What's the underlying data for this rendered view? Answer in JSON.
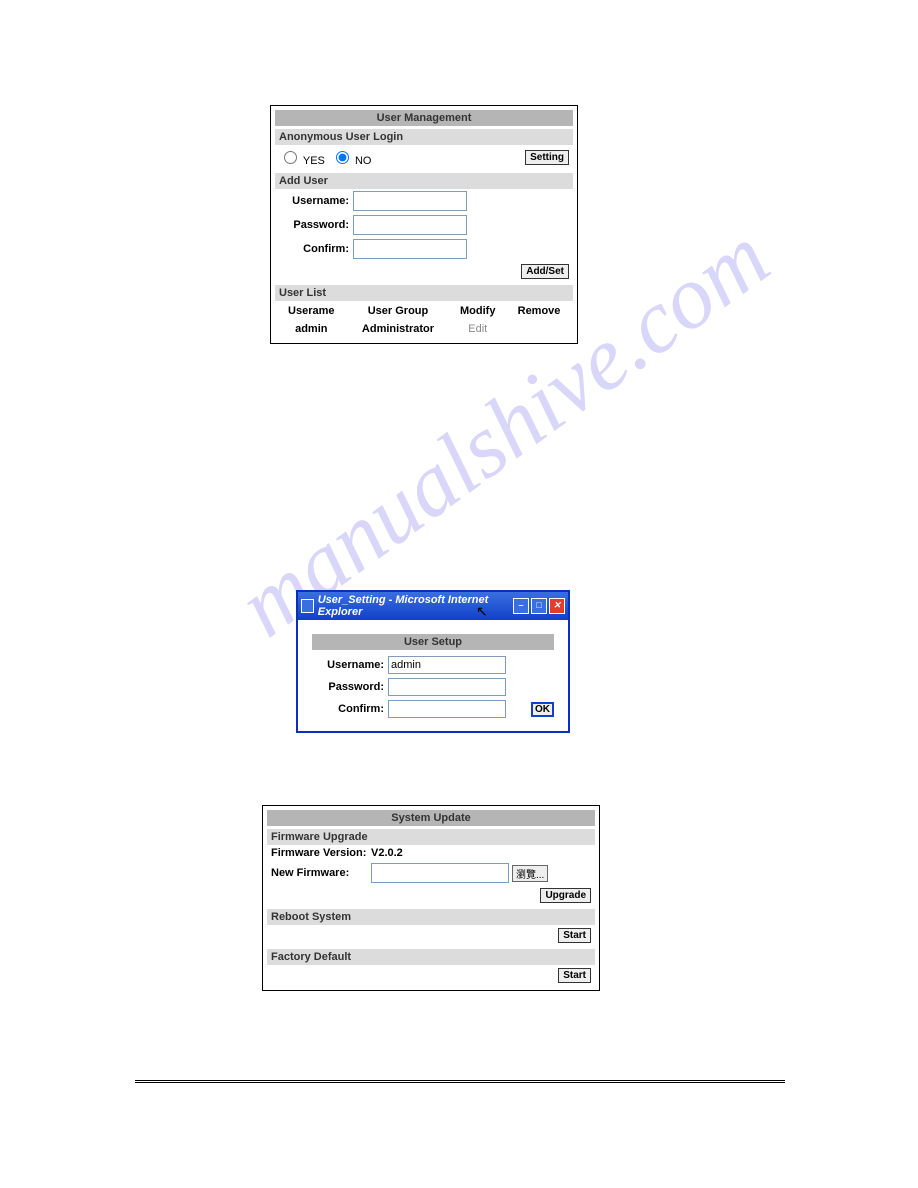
{
  "watermark": "manualshive.com",
  "panel1": {
    "title": "User Management",
    "section_anon": "Anonymous User Login",
    "yes": "YES",
    "no": "NO",
    "setting_btn": "Setting",
    "section_add": "Add User",
    "username_lbl": "Username:",
    "password_lbl": "Password:",
    "confirm_lbl": "Confirm:",
    "addset_btn": "Add/Set",
    "section_list": "User List",
    "col_user": "Userame",
    "col_group": "User Group",
    "col_modify": "Modify",
    "col_remove": "Remove",
    "row_user": "admin",
    "row_group": "Administrator",
    "row_modify": "Edit"
  },
  "dialog2": {
    "titlebar": "User_Setting - Microsoft Internet Explorer",
    "setup_title": "User Setup",
    "username_lbl": "Username:",
    "username_val": "admin",
    "password_lbl": "Password:",
    "confirm_lbl": "Confirm:",
    "ok": "OK"
  },
  "panel3": {
    "title": "System Update",
    "section_fw": "Firmware Upgrade",
    "ver_lbl": "Firmware Version:",
    "ver_val": "V2.0.2",
    "newfw_lbl": "New Firmware:",
    "browse": "瀏覽...",
    "upgrade_btn": "Upgrade",
    "section_reboot": "Reboot System",
    "start_btn": "Start",
    "section_factory": "Factory Default"
  }
}
